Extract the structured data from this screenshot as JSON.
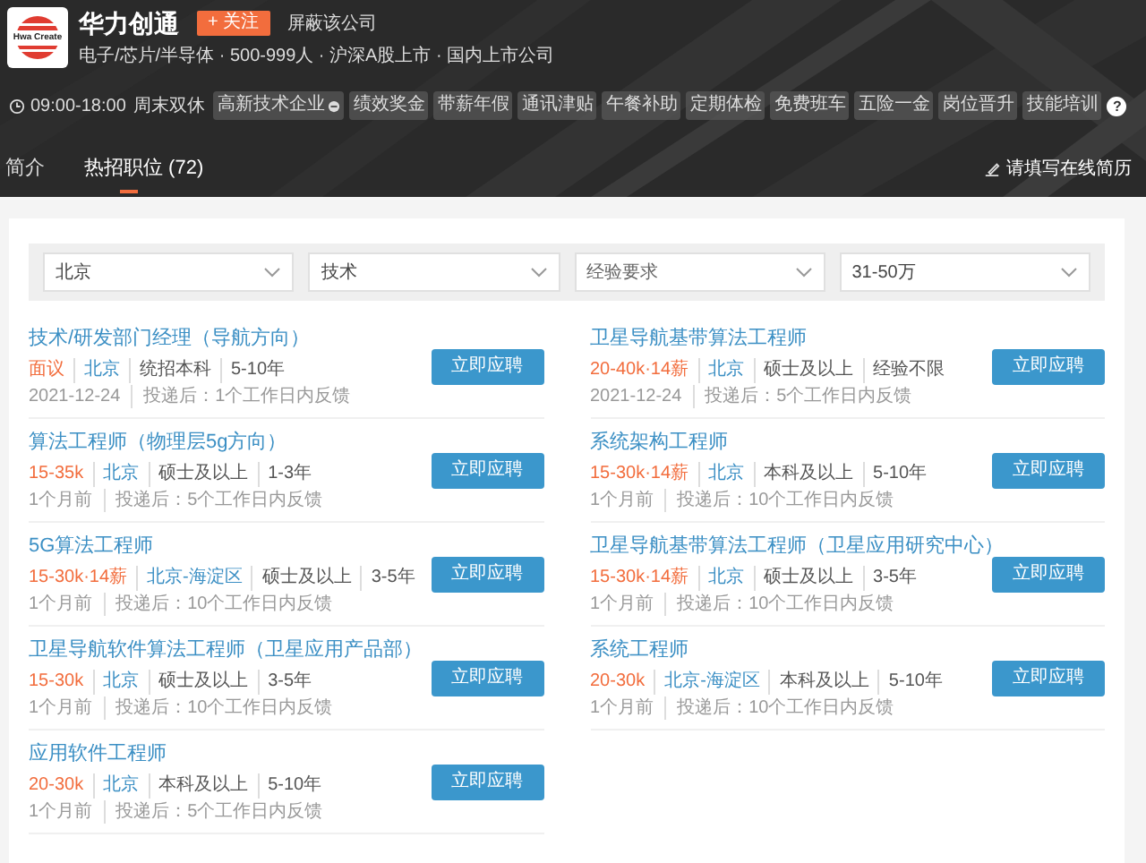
{
  "company": {
    "logo_text": "Hwa Create",
    "name": "华力创通",
    "follow_button": "+ 关注",
    "block_link": "屏蔽该公司",
    "info": "电子/芯片/半导体 · 500-999人 · 沪深A股上市 · 国内上市公司",
    "hours": "09:00-18:00",
    "rest": "周末双休",
    "tags": [
      {
        "label": "高新技术企业",
        "kind": "verified"
      },
      {
        "label": "绩效奖金",
        "kind": "plain"
      },
      {
        "label": "带薪年假",
        "kind": "plain"
      },
      {
        "label": "通讯津贴",
        "kind": "plain"
      },
      {
        "label": "午餐补助",
        "kind": "plain"
      },
      {
        "label": "定期体检",
        "kind": "plain"
      },
      {
        "label": "免费班车",
        "kind": "plain"
      },
      {
        "label": "五险一金",
        "kind": "plain"
      },
      {
        "label": "岗位晋升",
        "kind": "plain"
      },
      {
        "label": "技能培训",
        "kind": "plain"
      }
    ],
    "help": "?"
  },
  "tabs": [
    {
      "label": "简介",
      "selected": false
    },
    {
      "label": "热招职位 (72)",
      "selected": true
    }
  ],
  "resume_link": "请填写在线简历",
  "filters": [
    {
      "value": "北京"
    },
    {
      "value": "技术"
    },
    {
      "placeholder": "经验要求"
    },
    {
      "value": "31-50万"
    }
  ],
  "jobs": [
    {
      "title": "技术/研发部门经理（导航方向）",
      "salary": "面议",
      "location": "北京",
      "education": "统招本科",
      "experience": "5-10年",
      "posted": "2021-12-24",
      "feedback": "投递后：1个工作日内反馈",
      "button": "立即应聘"
    },
    {
      "title": "卫星导航基带算法工程师",
      "salary": "20-40k·14薪",
      "location": "北京",
      "education": "硕士及以上",
      "experience": "经验不限",
      "posted": "2021-12-24",
      "feedback": "投递后：5个工作日内反馈",
      "button": "立即应聘"
    },
    {
      "title": "算法工程师（物理层5g方向）",
      "salary": "15-35k",
      "location": "北京",
      "education": "硕士及以上",
      "experience": "1-3年",
      "posted": "1个月前",
      "feedback": "投递后：5个工作日内反馈",
      "button": "立即应聘"
    },
    {
      "title": "系统架构工程师",
      "salary": "15-30k·14薪",
      "location": "北京",
      "education": "本科及以上",
      "experience": "5-10年",
      "posted": "1个月前",
      "feedback": "投递后：10个工作日内反馈",
      "button": "立即应聘"
    },
    {
      "title": "5G算法工程师",
      "salary": "15-30k·14薪",
      "location": "北京-海淀区",
      "education": "硕士及以上",
      "experience": "3-5年",
      "posted": "1个月前",
      "feedback": "投递后：10个工作日内反馈",
      "button": "立即应聘"
    },
    {
      "title": "卫星导航基带算法工程师（卫星应用研究中心）",
      "salary": "15-30k·14薪",
      "location": "北京",
      "education": "硕士及以上",
      "experience": "3-5年",
      "posted": "1个月前",
      "feedback": "投递后：10个工作日内反馈",
      "button": "立即应聘"
    },
    {
      "title": "卫星导航软件算法工程师（卫星应用产品部）",
      "salary": "15-30k",
      "location": "北京",
      "education": "硕士及以上",
      "experience": "3-5年",
      "posted": "1个月前",
      "feedback": "投递后：10个工作日内反馈",
      "button": "立即应聘"
    },
    {
      "title": "系统工程师",
      "salary": "20-30k",
      "location": "北京-海淀区",
      "education": "本科及以上",
      "experience": "5-10年",
      "posted": "1个月前",
      "feedback": "投递后：10个工作日内反馈",
      "button": "立即应聘"
    },
    {
      "title": "应用软件工程师",
      "salary": "20-30k",
      "location": "北京",
      "education": "本科及以上",
      "experience": "5-10年",
      "posted": "1个月前",
      "feedback": "投递后：5个工作日内反馈",
      "button": "立即应聘"
    }
  ]
}
